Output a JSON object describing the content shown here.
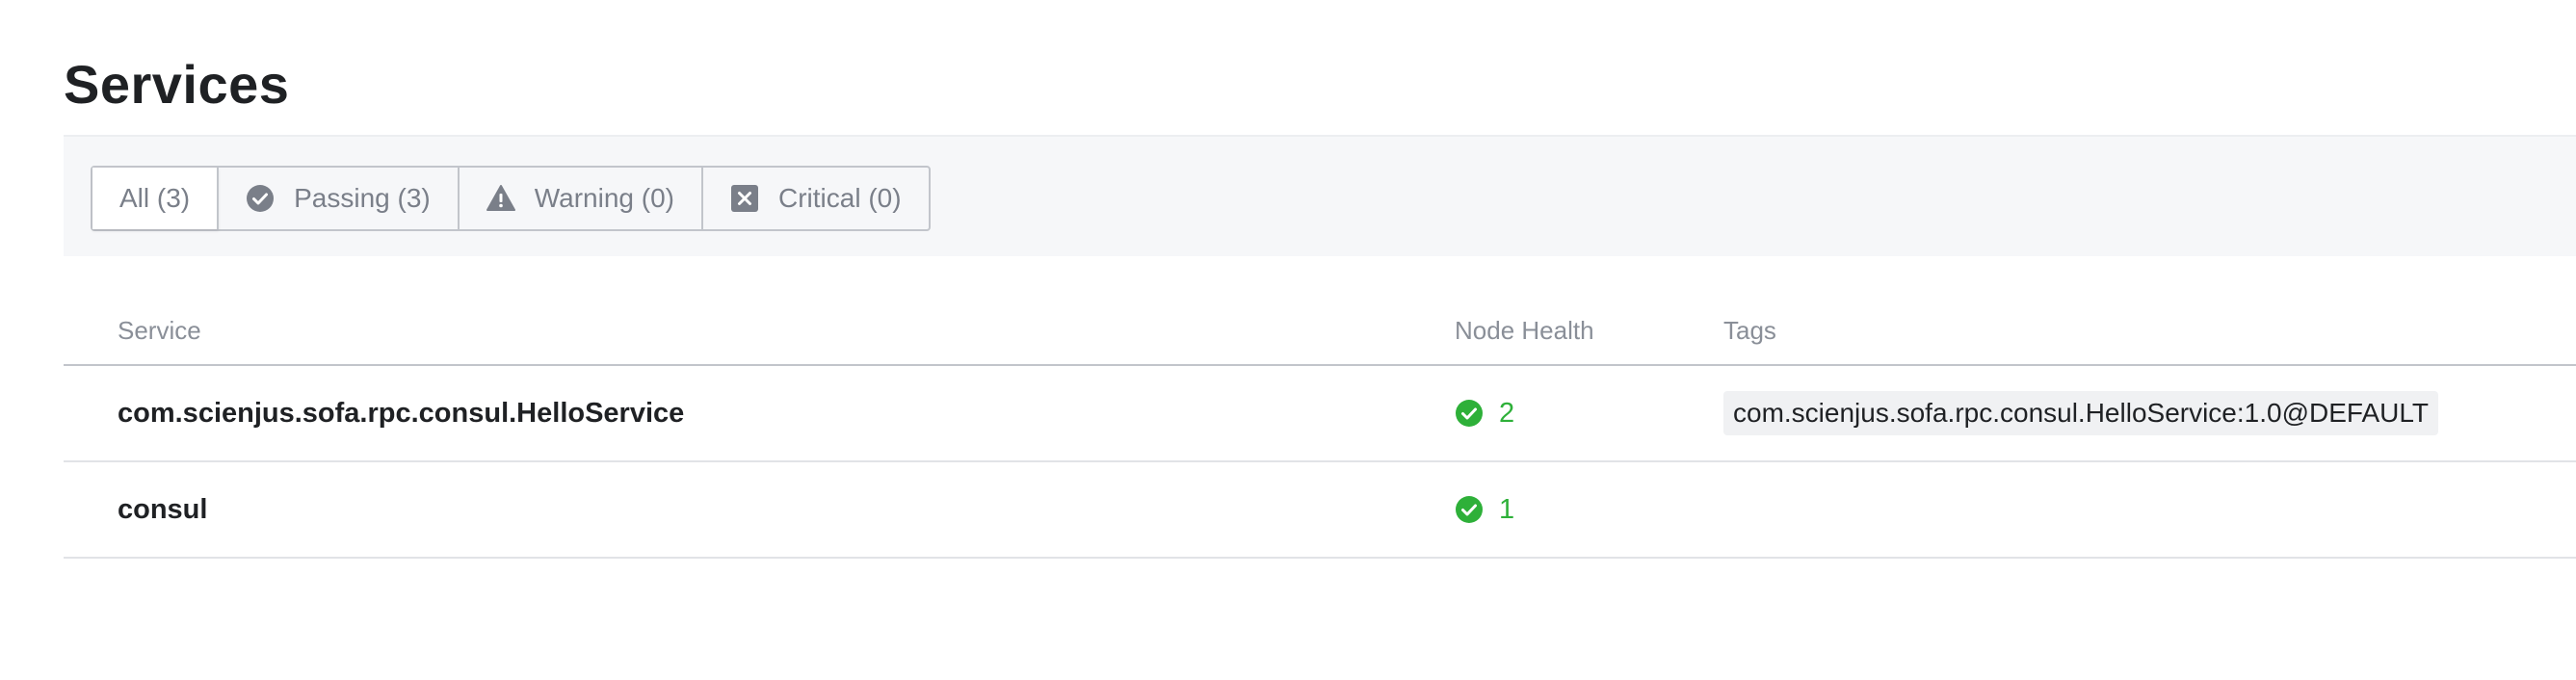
{
  "page": {
    "title": "Services"
  },
  "filters": [
    {
      "label": "All (3)",
      "icon": null,
      "active": true
    },
    {
      "label": "Passing (3)",
      "icon": "check-circle-icon",
      "active": false
    },
    {
      "label": "Warning (0)",
      "icon": "warning-triangle-icon",
      "active": false
    },
    {
      "label": "Critical (0)",
      "icon": "x-square-icon",
      "active": false
    }
  ],
  "table": {
    "columns": [
      "Service",
      "Node Health",
      "Tags"
    ],
    "rows": [
      {
        "service": "com.scienjus.sofa.rpc.consul.HelloService",
        "health": "2",
        "tags": [
          "com.scienjus.sofa.rpc.consul.HelloService:1.0@DEFAULT"
        ]
      },
      {
        "service": "consul",
        "health": "1",
        "tags": []
      }
    ]
  },
  "colors": {
    "passing": "#2eb039",
    "filter_icon": "#7a7f89",
    "border": "#c2c5cb",
    "tag_background": "#f0f1f3"
  }
}
